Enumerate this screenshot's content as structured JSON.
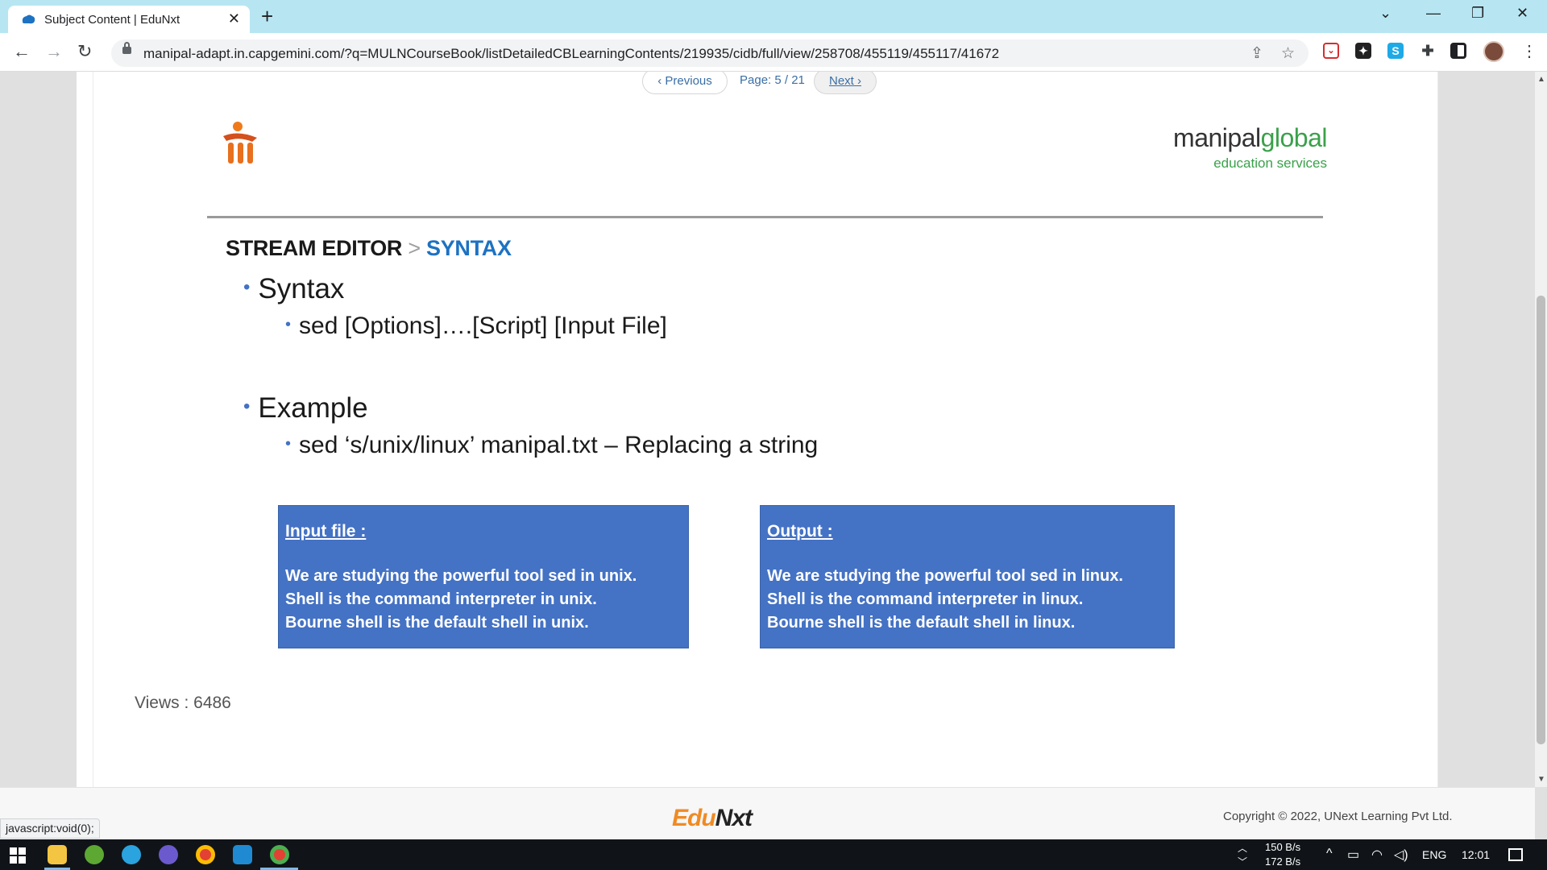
{
  "browser": {
    "tab_title": "Subject Content | EduNxt",
    "url": "manipal-adapt.in.capgemini.com/?q=MULNCourseBook/listDetailedCBLearningContents/219935/cidb/full/view/258708/455119/455117/41672",
    "new_tab": "+",
    "close_tab": "✕"
  },
  "pager": {
    "previous_label": "‹ Previous",
    "page_label": "Page: 5 / 21",
    "next_label": "Next ›"
  },
  "slide": {
    "brand_manipal": "manipal",
    "brand_global": "global",
    "brand_sub": "education services",
    "heading_main": "STREAM EDITOR",
    "heading_sep": ">",
    "heading_sub": "SYNTAX",
    "bullets": [
      {
        "text": "Syntax",
        "sub": "sed  [Options]….[Script] [Input File]"
      },
      {
        "text": "Example",
        "sub": "sed  ‘s/unix/linux’ manipal.txt – Replacing a string"
      }
    ],
    "input_box": {
      "title": "Input file :",
      "lines": [
        "We are studying the powerful tool sed in unix.",
        "Shell is the command interpreter in unix.",
        "Bourne shell is the default shell in unix."
      ]
    },
    "output_box": {
      "title": "Output :",
      "lines": [
        "We are studying the powerful tool sed in linux.",
        "Shell is the command interpreter in linux.",
        "Bourne shell is the default shell in linux."
      ]
    }
  },
  "views": "Views :   6486",
  "footer": {
    "logo_edu": "Edu",
    "logo_nxt": "Nxt",
    "copyright": "Copyright © 2022, UNext Learning Pvt Ltd."
  },
  "status_bar": "javascript:void(0);",
  "taskbar": {
    "net_up": "150 B/s",
    "net_down": "172 B/s",
    "language": "ENG",
    "time": "12:01"
  },
  "colors": {
    "accent_blue": "#4472c4",
    "heading_blue": "#1d72c2",
    "brand_green": "#3aa14a",
    "edunxt_orange": "#f08a24"
  }
}
